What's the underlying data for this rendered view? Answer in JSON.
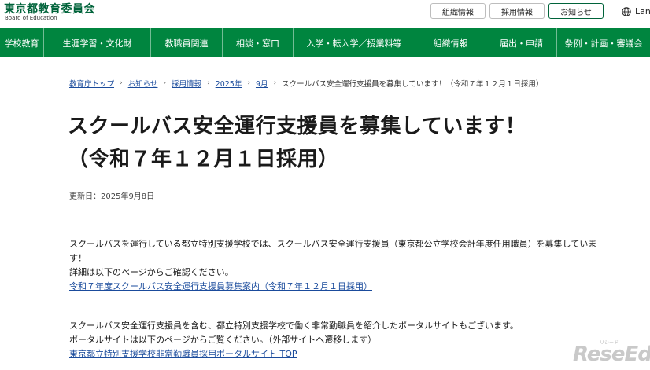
{
  "header": {
    "logo_title": "東京都教育委員会",
    "logo_subtitle": "Board of Education",
    "links": [
      "組織情報",
      "採用情報",
      "お知らせ"
    ],
    "language_label": "Lan"
  },
  "nav": {
    "items": [
      "学校教育",
      "生涯学習・文化財",
      "教職員関連",
      "相談・窓口",
      "入学・転入学／授業料等",
      "組織情報",
      "届出・申請",
      "条例・計画・審議会"
    ]
  },
  "breadcrumb": {
    "links": [
      "教育庁トップ",
      "お知らせ",
      "採用情報",
      "2025年",
      "9月"
    ],
    "current": "スクールバス安全運行支援員を募集しています！（令和７年１２月１日採用）"
  },
  "page": {
    "title_line1": "スクールバス安全運行支援員を募集しています！",
    "title_line2": "（令和７年１２月１日採用）",
    "updated": "更新日：2025年9月8日"
  },
  "body": {
    "p1_line1": "スクールバスを運行している都立特別支援学校では、スクールバス安全運行支援員（東京都公立学校会計年度任用職員）を募集していま",
    "p1_line2": "す！",
    "p1_line3": "詳細は以下のページからご確認ください。",
    "p1_link": "令和７年度スクールバス安全運行支援員募集案内（令和７年１２月１日採用）",
    "p2_line1": "スクールバス安全運行支援員を含む、都立特別支援学校で働く非常勤職員を紹介したポータルサイトもございます。",
    "p2_line2": "ポータルサイトは以下のページからご覧ください。（外部サイトへ遷移します）",
    "p2_link": "東京都立特別支援学校非常勤職員採用ポータルサイト TOP"
  },
  "watermark": {
    "brand": "ReseEd",
    "small": "リシード"
  },
  "colors": {
    "nav_bg": "#00853f",
    "logo": "#00633a",
    "link": "#1a4b9c"
  }
}
